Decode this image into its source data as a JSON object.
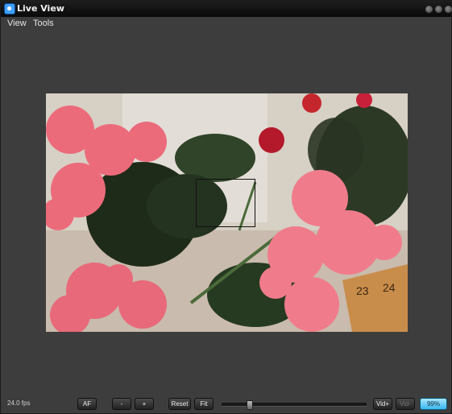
{
  "window": {
    "title": "Live View"
  },
  "menu": {
    "items": [
      "View",
      "Tools"
    ]
  },
  "status": {
    "fps": "24.0 fps",
    "af_label": "AF",
    "minus_label": "-",
    "plus_label": "+",
    "reset_label": "Reset",
    "fit_label": "Fit",
    "vid_plus_label": "Vid+",
    "vid_minus_label": "Vid-",
    "zoom": "99%",
    "slider_fraction": 0.18
  },
  "colors": {
    "titlebar": "#0a0a0a",
    "window_bg": "#3d3d3d",
    "accent": "#39b8ee"
  },
  "icons": [
    "app-icon",
    "minimize-icon",
    "maximize-icon",
    "close-icon"
  ]
}
